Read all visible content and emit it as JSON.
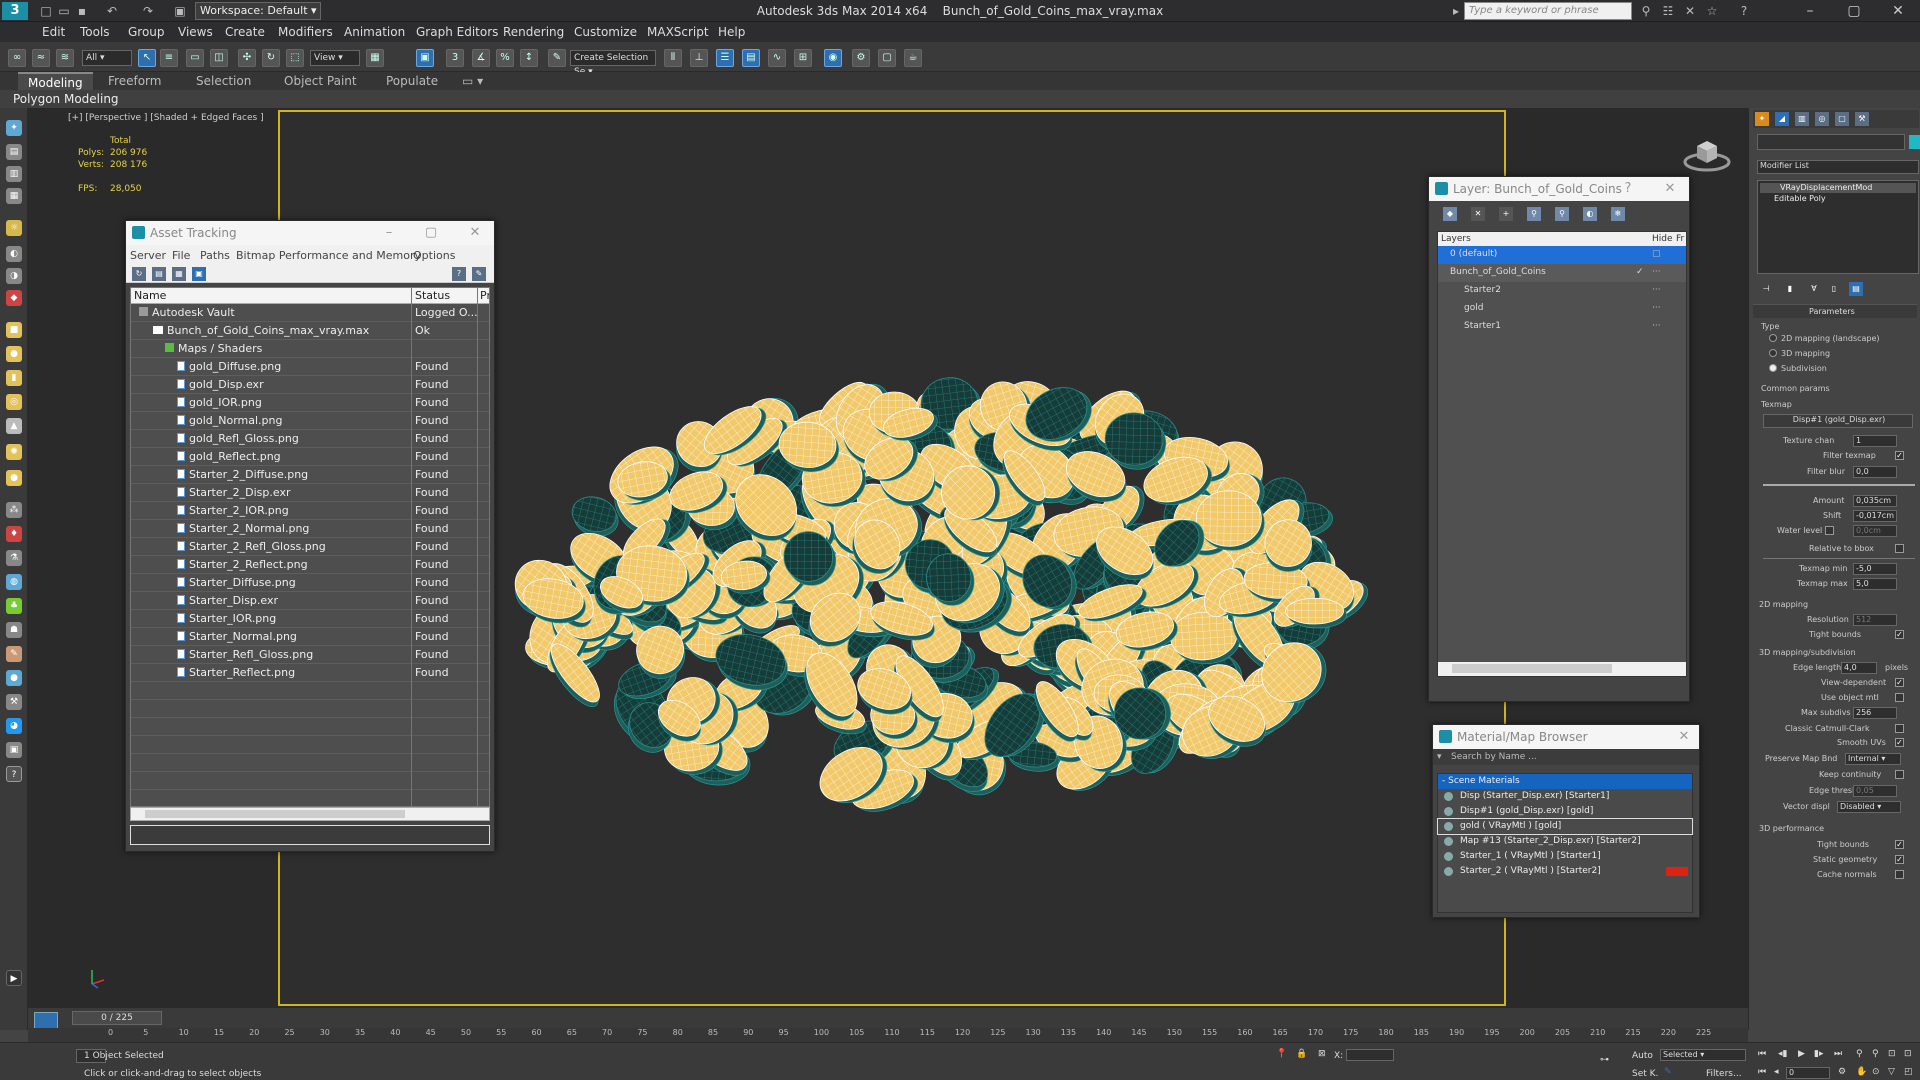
{
  "titlebar": {
    "workspace": "Workspace: Default",
    "app": "Autodesk 3ds Max  2014 x64",
    "file": "Bunch_of_Gold_Coins_max_vray.max",
    "search_placeholder": "Type a keyword or phrase"
  },
  "menu": [
    "Edit",
    "Tools",
    "Group",
    "Views",
    "Create",
    "Modifiers",
    "Animation",
    "Graph Editors",
    "Rendering",
    "Customize",
    "MAXScript",
    "Help"
  ],
  "toolbar": {
    "filter": "All",
    "view": "View",
    "selset": "Create Selection Se"
  },
  "ribbon": {
    "tabs": [
      "Modeling",
      "Freeform",
      "Selection",
      "Object Paint",
      "Populate"
    ],
    "sub": "Polygon Modeling"
  },
  "viewport": {
    "label": "[+] [Perspective ] [Shaded + Edged Faces ]",
    "total_label": "Total",
    "polys_label": "Polys:",
    "polys": "206 976",
    "verts_label": "Verts:",
    "verts": "208 176",
    "fps_label": "FPS:",
    "fps": "28,050"
  },
  "asset_tracking": {
    "title": "Asset Tracking",
    "menus": [
      "Server",
      "File",
      "Paths",
      "Bitmap Performance and Memory",
      "Options"
    ],
    "cols": {
      "name": "Name",
      "status": "Status",
      "pr": "Pr"
    },
    "rows": [
      {
        "name": "Autodesk Vault",
        "status": "Logged O..."
      },
      {
        "name": "Bunch_of_Gold_Coins_max_vray.max",
        "status": "Ok"
      },
      {
        "name": "Maps / Shaders",
        "status": ""
      },
      {
        "name": "gold_Diffuse.png",
        "status": "Found"
      },
      {
        "name": "gold_Disp.exr",
        "status": "Found"
      },
      {
        "name": "gold_IOR.png",
        "status": "Found"
      },
      {
        "name": "gold_Normal.png",
        "status": "Found"
      },
      {
        "name": "gold_Refl_Gloss.png",
        "status": "Found"
      },
      {
        "name": "gold_Reflect.png",
        "status": "Found"
      },
      {
        "name": "Starter_2_Diffuse.png",
        "status": "Found"
      },
      {
        "name": "Starter_2_Disp.exr",
        "status": "Found"
      },
      {
        "name": "Starter_2_IOR.png",
        "status": "Found"
      },
      {
        "name": "Starter_2_Normal.png",
        "status": "Found"
      },
      {
        "name": "Starter_2_Refl_Gloss.png",
        "status": "Found"
      },
      {
        "name": "Starter_2_Reflect.png",
        "status": "Found"
      },
      {
        "name": "Starter_Diffuse.png",
        "status": "Found"
      },
      {
        "name": "Starter_Disp.exr",
        "status": "Found"
      },
      {
        "name": "Starter_IOR.png",
        "status": "Found"
      },
      {
        "name": "Starter_Normal.png",
        "status": "Found"
      },
      {
        "name": "Starter_Refl_Gloss.png",
        "status": "Found"
      },
      {
        "name": "Starter_Reflect.png",
        "status": "Found"
      }
    ]
  },
  "layer": {
    "title": "Layer: Bunch_of_Gold_Coins",
    "cols": {
      "layers": "Layers",
      "hide": "Hide",
      "fr": "Fr"
    },
    "rows": [
      "0 (default)",
      "Bunch_of_Gold_Coins",
      "Starter2",
      "gold",
      "Starter1"
    ]
  },
  "material_browser": {
    "title": "Material/Map Browser",
    "search": "Search by Name ...",
    "group": "- Scene Materials",
    "rows": [
      "Disp (Starter_Disp.exr) [Starter1]",
      "Disp#1 (gold_Disp.exr) [gold]",
      "gold  ( VRayMtl ) [gold]",
      "Map #13 (Starter_2_Disp.exr) [Starter2]",
      "Starter_1  ( VRayMtl ) [Starter1]",
      "Starter_2  ( VRayMtl ) [Starter2]"
    ]
  },
  "command_panel": {
    "modifier_list": "Modifier List",
    "stack": [
      "VRayDisplacementMod",
      "Editable Poly"
    ],
    "parameters": "Parameters",
    "type": "Type",
    "type_opts": [
      "2D mapping (landscape)",
      "3D mapping",
      "Subdivision"
    ],
    "common": "Common params",
    "texmap": "Texmap",
    "texmap_value": "Disp#1 (gold_Disp.exr)",
    "texture_chan": "Texture chan",
    "texture_chan_v": "1",
    "filter_texmap": "Filter texmap",
    "filter_blur": "Filter blur",
    "filter_blur_v": "0,0",
    "amount": "Amount",
    "amount_v": "0,035cm",
    "shift": "Shift",
    "shift_v": "-0,017cm",
    "water": "Water level",
    "water_v": "0,0cm",
    "relbbox": "Relative to bbox",
    "tmin": "Texmap min",
    "tmin_v": "-5,0",
    "tmax": "Texmap max",
    "tmax_v": "5,0",
    "map2d": "2D mapping",
    "resolution": "Resolution",
    "resolution_v": "512",
    "tight": "Tight bounds",
    "map3d": "3D mapping/subdivision",
    "edge_len": "Edge length",
    "edge_len_v": "4,0",
    "pixels": "pixels",
    "view_dep": "View-dependent",
    "use_obj": "Use object mtl",
    "max_sub": "Max subdivs",
    "max_sub_v": "256",
    "catmull": "Classic Catmull-Clark",
    "smooth": "Smooth UVs",
    "preserve": "Preserve Map Bnd",
    "preserve_v": "Internal",
    "keep": "Keep continuity",
    "edge_thresh": "Edge thresh",
    "edge_thresh_v": "0,05",
    "vector": "Vector displ",
    "vector_v": "Disabled",
    "perf": "3D performance",
    "tight2": "Tight bounds",
    "static": "Static geometry",
    "cache": "Cache normals"
  },
  "timeline": {
    "frame": "0 / 225",
    "ticks": [
      "0",
      "5",
      "10",
      "15",
      "20",
      "25",
      "30",
      "35",
      "40",
      "45",
      "50",
      "55",
      "60",
      "65",
      "70",
      "75",
      "80",
      "85",
      "90",
      "95",
      "100",
      "105",
      "110",
      "115",
      "120",
      "125",
      "130",
      "135",
      "140",
      "145",
      "150",
      "155",
      "160",
      "165",
      "170",
      "175",
      "180",
      "185",
      "190",
      "195",
      "200",
      "205",
      "210",
      "215",
      "220",
      "225"
    ]
  },
  "status": {
    "selected": "1 Object Selected",
    "hint": "Click or click-and-drag to select objects",
    "x_label": "X:",
    "auto": "Auto",
    "selected_dd": "Selected",
    "setk": "Set K.",
    "filters": "Filters...",
    "frame_v": "0"
  }
}
